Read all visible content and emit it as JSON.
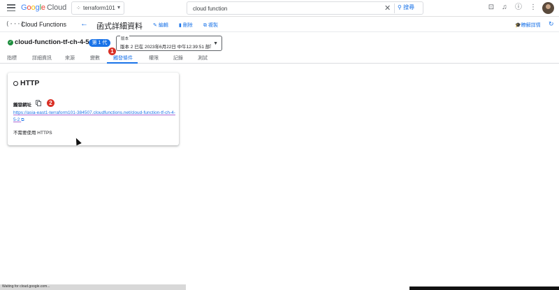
{
  "topbar": {
    "logo": {
      "g1": "G",
      "g2": "o",
      "g3": "o",
      "g4": "g",
      "g5": "l",
      "g6": "e",
      "product": "Cloud"
    },
    "project": "terraform101",
    "search": {
      "value": "cloud function",
      "button": "搜尋"
    },
    "icons": [
      "terminal-icon",
      "bell-icon",
      "help-icon",
      "more-vert-icon"
    ]
  },
  "subbar": {
    "service_title": "Cloud Functions",
    "page_title": "函式詳細資料",
    "actions": {
      "edit": "編輯",
      "delete": "刪除",
      "copy": "複製"
    },
    "learn": "瞭解詳情"
  },
  "function": {
    "name": "cloud-function-tf-ch-4-5-2",
    "generation": "第 1 代",
    "version_label": "版本",
    "version_value": "版本 2 已在 2023年6月22日 中午12:39:51 部署..."
  },
  "tabs": [
    "指標",
    "詳細資訊",
    "來源",
    "變數",
    "觸發條件",
    "權限",
    "記錄",
    "測試"
  ],
  "active_tab": 4,
  "markers": [
    "1",
    "2"
  ],
  "card": {
    "title": "HTTP",
    "url_label": "觸發網址",
    "url": "https://asia-east1-terraform101-384507.cloudfunctions.net/cloud-function-tf-ch-4-5-2",
    "https_note": "不需要使用 HTTPS"
  },
  "status_text": "Waiting for cloud.google.com...",
  "colors": {
    "accent": "#1a73e8",
    "success": "#1e8e3e",
    "marker": "#d93025"
  }
}
